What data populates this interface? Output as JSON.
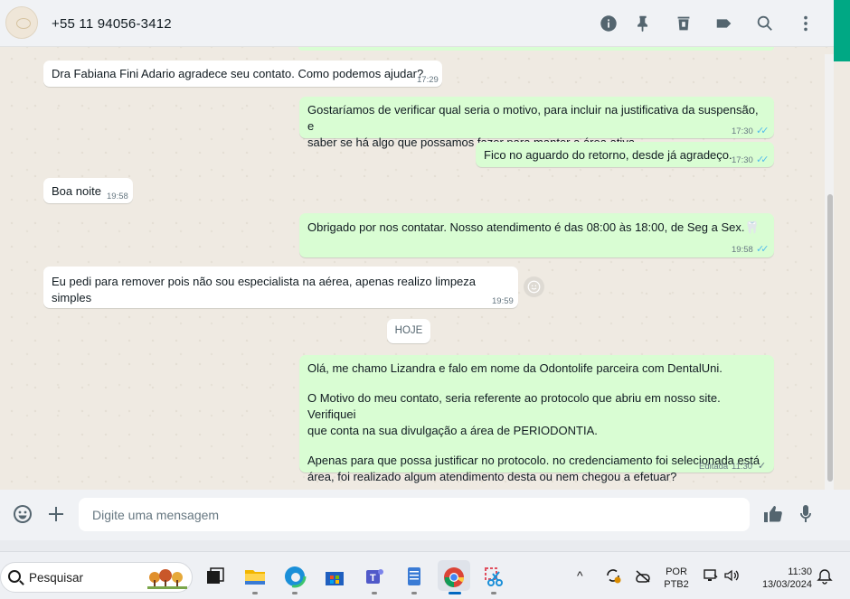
{
  "header": {
    "contact": "+55 11 94056-3412",
    "icons": [
      "info-icon",
      "pin-icon",
      "trash-icon",
      "label-icon",
      "search-icon",
      "menu-icon"
    ]
  },
  "messages": [
    {
      "dir": "in",
      "text": "Dra Fabiana Fini Adario agradece seu contato. Como podemos ajudar?",
      "time": "17:29"
    },
    {
      "dir": "out",
      "lines": [
        "Gostaríamos de verificar qual seria o motivo, para incluir na justificativa da suspensão, e",
        "saber se há algo que possamos fazer para manter a área ativa."
      ],
      "time": "17:30"
    },
    {
      "dir": "out",
      "text": "Fico no aguardo do retorno, desde já agradeço.",
      "time": "17:30"
    },
    {
      "dir": "in",
      "text": "Boa noite",
      "time": "19:58"
    },
    {
      "dir": "out",
      "text": "Obrigado por nos contatar. Nosso atendimento é das 08:00 às 18:00, de Seg a Sex.🦷",
      "time": "19:58"
    },
    {
      "dir": "in",
      "text": "Eu pedi para remover pois não sou especialista na aérea, apenas realizo limpeza simples",
      "time": "19:59"
    },
    {
      "dir": "out",
      "paragraphs": [
        "Olá, me chamo Lizandra e falo em nome da Odontolife parceira com DentalUni.",
        "O Motivo do meu contato, seria referente ao protocolo que abriu em nosso site. Verifiquei que conta na sua divulgação a área de PERIODONTIA.",
        "Apenas para que possa justificar no protocolo. no credenciamento foi selecionada está área, foi realizado algum atendimento desta ou nem chegou a efetuar?"
      ],
      "p1": "Olá, me chamo Lizandra e falo em nome da Odontolife parceira com DentalUni.",
      "p2a": "O Motivo do meu contato, seria referente ao protocolo que abriu em nosso site. Verifiquei",
      "p2b": "que conta na sua divulgação a área de PERIODONTIA.",
      "p3a": "Apenas para que possa justificar no protocolo. no credenciamento foi selecionada está",
      "p3b": "área, foi realizado algum atendimento desta ou nem chegou a efetuar?",
      "edited": "Editada",
      "time": "11:30"
    }
  ],
  "date_chip": "HOJE",
  "composer": {
    "placeholder": "Digite uma mensagem"
  },
  "taskbar": {
    "search": "Pesquisar",
    "lang_top": "POR",
    "lang_bottom": "PTB2",
    "clock_time": "11:30",
    "clock_date": "13/03/2024"
  },
  "colors": {
    "outgoing": "#d9fdd3",
    "incoming": "#ffffff",
    "accent": "#00a884",
    "read_tick": "#53bdeb"
  }
}
